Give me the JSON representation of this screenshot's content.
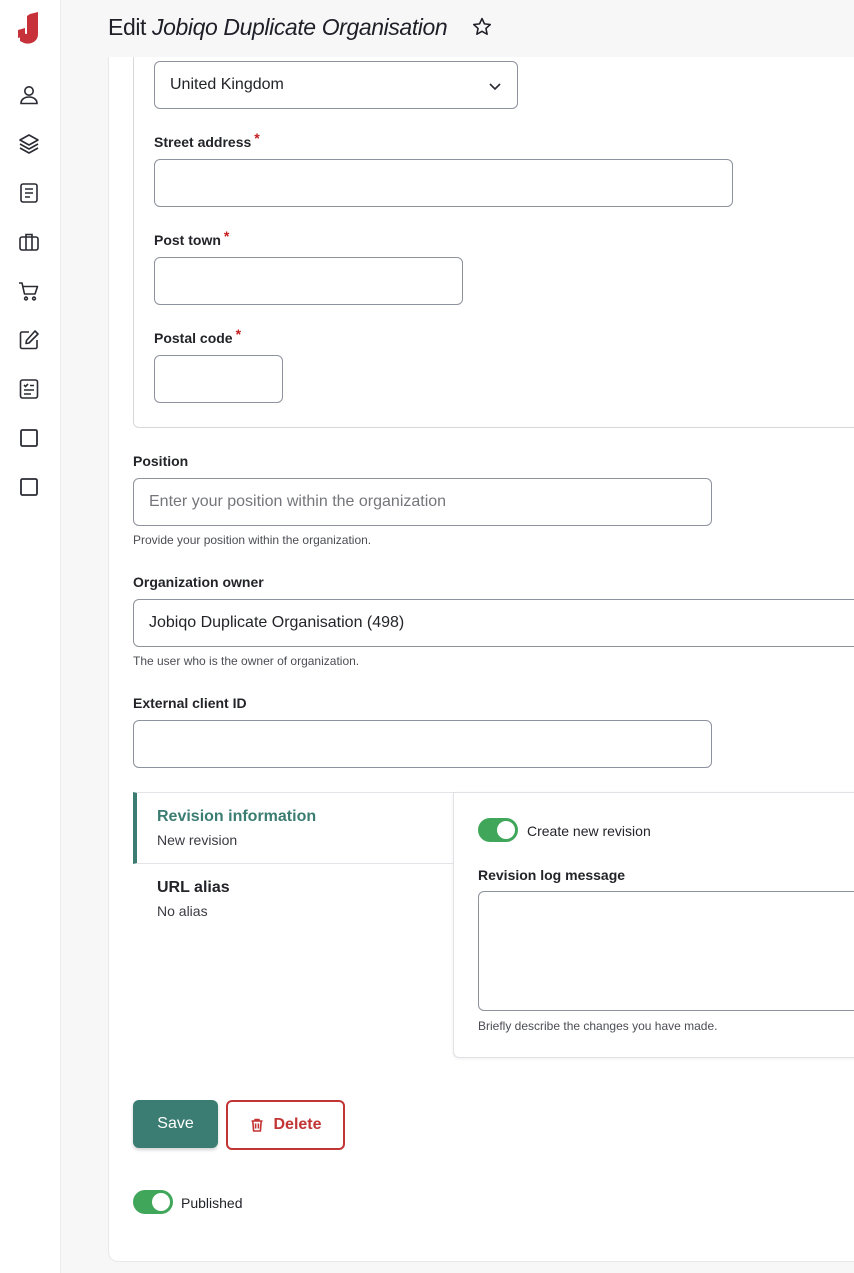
{
  "header": {
    "title_prefix": "Edit",
    "title_entity": "Jobiqo Duplicate Organisation"
  },
  "address": {
    "country_value": "United Kingdom",
    "street_label": "Street address",
    "post_town_label": "Post town",
    "postal_code_label": "Postal code",
    "required_mark": "*"
  },
  "position": {
    "label": "Position",
    "placeholder": "Enter your position within the organization",
    "help": "Provide your position within the organization."
  },
  "owner": {
    "label": "Organization owner",
    "value": "Jobiqo Duplicate Organisation (498)",
    "help": "The user who is the owner of organization."
  },
  "external_id": {
    "label": "External client ID"
  },
  "vertical_tabs": {
    "revision": {
      "title": "Revision information",
      "summary": "New revision"
    },
    "url_alias": {
      "title": "URL alias",
      "summary": "No alias"
    }
  },
  "revision_pane": {
    "toggle_label": "Create new revision",
    "log_label": "Revision log message",
    "log_help": "Briefly describe the changes you have made."
  },
  "actions": {
    "save_label": "Save",
    "delete_label": "Delete"
  },
  "status": {
    "published_label": "Published"
  },
  "colors": {
    "accent": "#3b7d72",
    "toggle_on": "#3fa65a",
    "danger": "#c23535",
    "logo": "#c7323a"
  },
  "icons": {
    "sidebar": [
      "user-icon",
      "layers-icon",
      "document-icon",
      "briefcase-icon",
      "cart-icon",
      "edit-icon",
      "form-icon",
      "square-icon",
      "square-icon"
    ],
    "title": "star-icon",
    "delete": "trash-icon"
  }
}
